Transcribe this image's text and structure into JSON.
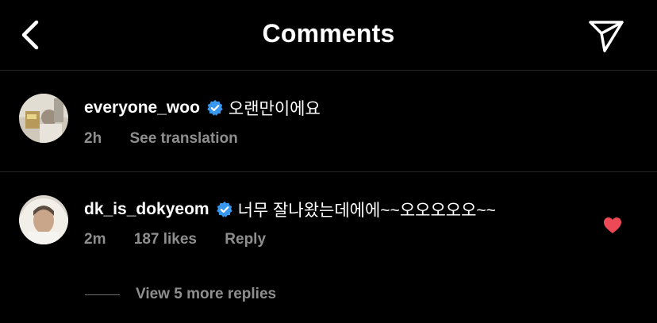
{
  "header": {
    "title": "Comments",
    "back_icon": "chevron-left-icon",
    "share_icon": "send-icon"
  },
  "comments": [
    {
      "username": "everyone_woo",
      "verified": true,
      "text": "오랜만이에요",
      "time": "2h",
      "action": "See translation"
    },
    {
      "username": "dk_is_dokyeom",
      "verified": true,
      "text": "너무 잘나왔는데에에~~오오오오오~~",
      "time": "2m",
      "likes": "187 likes",
      "reply_label": "Reply",
      "liked": true
    }
  ],
  "view_replies": "View 5 more replies",
  "colors": {
    "background": "#000000",
    "text": "#ffffff",
    "secondary": "#8e8e8e",
    "verified": "#3897f0",
    "heart": "#ed4956",
    "divider": "#262626"
  }
}
